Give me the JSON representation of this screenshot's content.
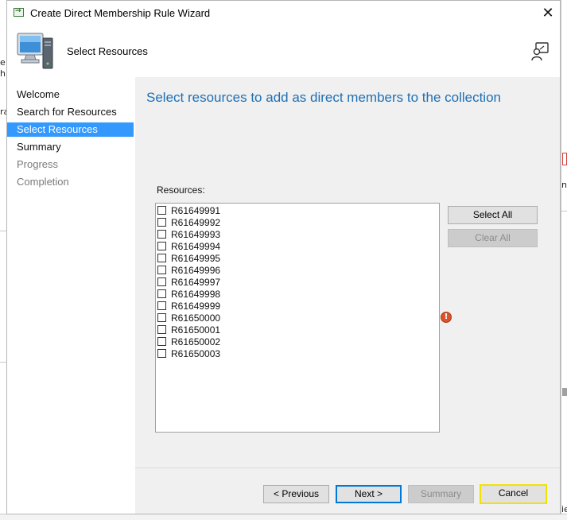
{
  "window": {
    "title": "Create Direct Membership Rule Wizard",
    "close_glyph": "✕"
  },
  "banner": {
    "title": "Select Resources",
    "icon": "computer-icon",
    "help_icon": "help-person-icon"
  },
  "nav": {
    "items": [
      {
        "label": "Welcome",
        "state": "normal"
      },
      {
        "label": "Search for Resources",
        "state": "normal"
      },
      {
        "label": "Select Resources",
        "state": "selected"
      },
      {
        "label": "Summary",
        "state": "normal"
      },
      {
        "label": "Progress",
        "state": "disabled"
      },
      {
        "label": "Completion",
        "state": "disabled"
      }
    ]
  },
  "main": {
    "heading": "Select resources to add as direct members to the collection",
    "resources_label": "Resources:",
    "resources": [
      "R61649991",
      "R61649992",
      "R61649993",
      "R61649994",
      "R61649995",
      "R61649996",
      "R61649997",
      "R61649998",
      "R61649999",
      "R61650000",
      "R61650001",
      "R61650002",
      "R61650003"
    ],
    "select_all_label": "Select All",
    "clear_all_label": "Clear All",
    "error_glyph": "!"
  },
  "footer": {
    "previous_label": "< Previous",
    "next_label": "Next >",
    "summary_label": "Summary",
    "cancel_label": "Cancel"
  },
  "background": {
    "left_fragments": [
      "e",
      "h",
      "ra"
    ],
    "right_fragments": [
      "n",
      "ie"
    ]
  },
  "colors": {
    "accent": "#3399ff",
    "heading": "#1f6fb5",
    "focus_border": "#0078d7",
    "cancel_highlight": "#f2e200",
    "error": "#d9532c"
  }
}
